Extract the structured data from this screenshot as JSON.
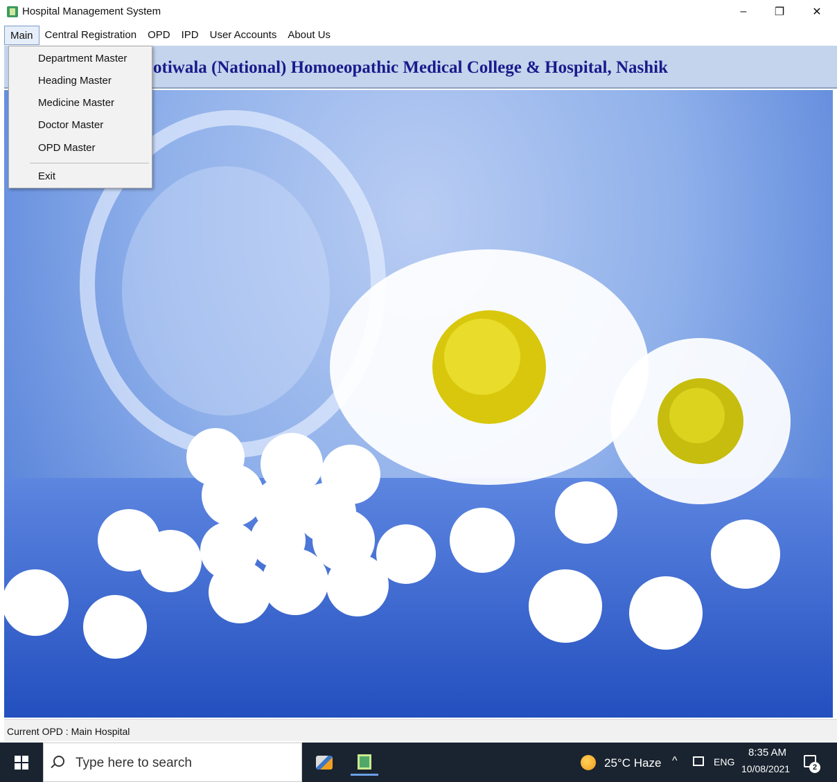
{
  "window": {
    "title": "Hospital Management System",
    "minimize_glyph": "–",
    "maximize_glyph": "❐",
    "close_glyph": "✕"
  },
  "menubar": {
    "items": [
      {
        "label": "Main",
        "active": true
      },
      {
        "label": "Central Registration"
      },
      {
        "label": "OPD"
      },
      {
        "label": "IPD"
      },
      {
        "label": "User Accounts"
      },
      {
        "label": "About Us"
      }
    ]
  },
  "dropdown": {
    "items": [
      {
        "label": "Department Master"
      },
      {
        "label": "Heading Master"
      },
      {
        "label": "Medicine Master"
      },
      {
        "label": "Doctor Master"
      },
      {
        "label": "OPD Master"
      },
      {
        "label": "Exit"
      }
    ]
  },
  "banner": {
    "title": "otiwala (National) Homoeopathic Medical College & Hospital, Nashik",
    "color": "#1a1a8c"
  },
  "statusbar": {
    "text": "Current OPD :   Main Hospital"
  },
  "taskbar": {
    "search_placeholder": "Type here to search",
    "weather": "25°C  Haze",
    "chevron": "^",
    "language": "ENG",
    "time": "8:35 AM",
    "date": "10/08/2021",
    "notification_count": "2"
  },
  "icons": {
    "app": "app-icon",
    "search": "search-icon",
    "weather": "weather-icon",
    "network": "network-icon",
    "notification": "notification-icon"
  }
}
